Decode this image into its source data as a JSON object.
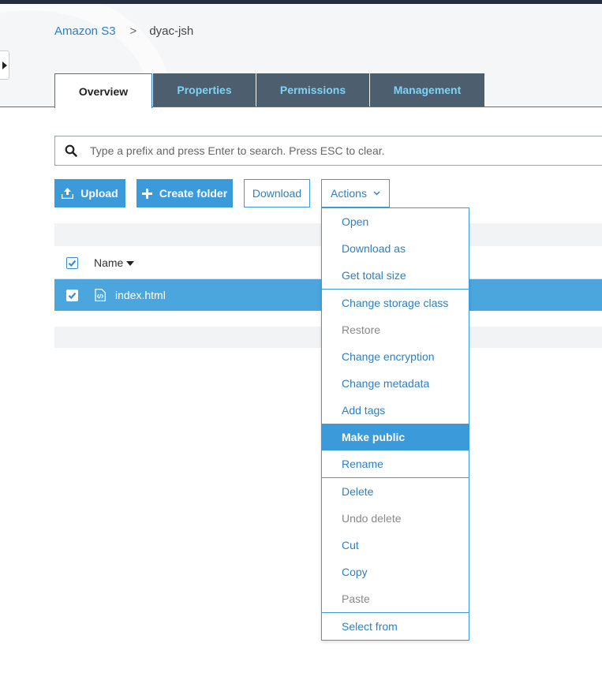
{
  "breadcrumb": {
    "root": "Amazon S3",
    "separator": ">",
    "current": "dyac-jsh"
  },
  "tabs": [
    {
      "label": "Overview",
      "active": true
    },
    {
      "label": "Properties",
      "active": false
    },
    {
      "label": "Permissions",
      "active": false
    },
    {
      "label": "Management",
      "active": false
    }
  ],
  "search": {
    "placeholder": "Type a prefix and press Enter to search. Press ESC to clear.",
    "icon": "search-icon"
  },
  "toolbar": {
    "upload_label": "Upload",
    "create_folder_label": "Create folder",
    "download_label": "Download",
    "actions_label": "Actions"
  },
  "table": {
    "name_header": "Name",
    "header_checked": true,
    "rows": [
      {
        "name": "index.html",
        "checked": true,
        "icon": "html-file-icon"
      }
    ]
  },
  "actions_menu": {
    "items": [
      {
        "label": "Open",
        "state": "enabled"
      },
      {
        "label": "Download as",
        "state": "enabled"
      },
      {
        "label": "Get total size",
        "state": "enabled"
      },
      {
        "label": "Change storage class",
        "state": "enabled"
      },
      {
        "label": "Restore",
        "state": "disabled"
      },
      {
        "label": "Change encryption",
        "state": "enabled"
      },
      {
        "label": "Change metadata",
        "state": "enabled"
      },
      {
        "label": "Add tags",
        "state": "enabled"
      },
      {
        "label": "Make public",
        "state": "highlighted"
      },
      {
        "label": "Rename",
        "state": "enabled"
      },
      {
        "label": "Delete",
        "state": "enabled"
      },
      {
        "label": "Undo delete",
        "state": "disabled"
      },
      {
        "label": "Cut",
        "state": "enabled"
      },
      {
        "label": "Copy",
        "state": "enabled"
      },
      {
        "label": "Paste",
        "state": "disabled"
      },
      {
        "label": "Select from",
        "state": "enabled"
      }
    ]
  },
  "colors": {
    "accent": "#3b9ad9",
    "link": "#2d7fc1",
    "tab_inactive_bg": "#4d5e6e",
    "tab_inactive_text": "#7fd3f5",
    "selected_row": "#4aa6dd",
    "top_bar": "#232f3e"
  }
}
